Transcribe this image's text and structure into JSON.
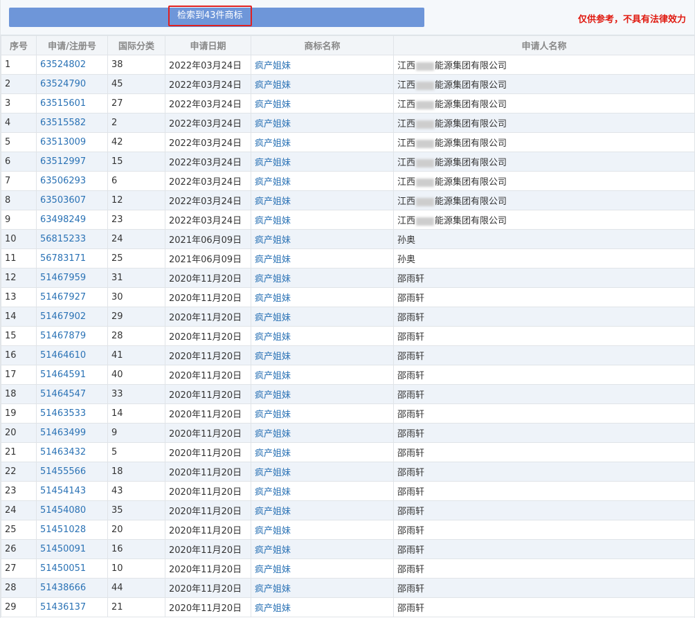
{
  "header": {
    "result_text": "检索到43件商标",
    "disclaimer": "仅供参考，不具有法律效力"
  },
  "table": {
    "columns": [
      "序号",
      "申请/注册号",
      "国际分类",
      "申请日期",
      "商标名称",
      "申请人名称"
    ],
    "rows": [
      {
        "seq": "1",
        "reg": "63524802",
        "cls": "38",
        "date": "2022年03月24日",
        "name": "疯产姐妹",
        "applicant_prefix": "江西",
        "applicant_suffix": "能源集团有限公司",
        "redacted": true
      },
      {
        "seq": "2",
        "reg": "63524790",
        "cls": "45",
        "date": "2022年03月24日",
        "name": "疯产姐妹",
        "applicant_prefix": "江西",
        "applicant_suffix": "能源集团有限公司",
        "redacted": true
      },
      {
        "seq": "3",
        "reg": "63515601",
        "cls": "27",
        "date": "2022年03月24日",
        "name": "疯产姐妹",
        "applicant_prefix": "江西",
        "applicant_suffix": "能源集团有限公司",
        "redacted": true
      },
      {
        "seq": "4",
        "reg": "63515582",
        "cls": "2",
        "date": "2022年03月24日",
        "name": "疯产姐妹",
        "applicant_prefix": "江西",
        "applicant_suffix": "能源集团有限公司",
        "redacted": true
      },
      {
        "seq": "5",
        "reg": "63513009",
        "cls": "42",
        "date": "2022年03月24日",
        "name": "疯产姐妹",
        "applicant_prefix": "江西",
        "applicant_suffix": "能源集团有限公司",
        "redacted": true
      },
      {
        "seq": "6",
        "reg": "63512997",
        "cls": "15",
        "date": "2022年03月24日",
        "name": "疯产姐妹",
        "applicant_prefix": "江西",
        "applicant_suffix": "能源集团有限公司",
        "redacted": true
      },
      {
        "seq": "7",
        "reg": "63506293",
        "cls": "6",
        "date": "2022年03月24日",
        "name": "疯产姐妹",
        "applicant_prefix": "江西",
        "applicant_suffix": "能源集团有限公司",
        "redacted": true
      },
      {
        "seq": "8",
        "reg": "63503607",
        "cls": "12",
        "date": "2022年03月24日",
        "name": "疯产姐妹",
        "applicant_prefix": "江西",
        "applicant_suffix": "能源集团有限公司",
        "redacted": true
      },
      {
        "seq": "9",
        "reg": "63498249",
        "cls": "23",
        "date": "2022年03月24日",
        "name": "疯产姐妹",
        "applicant_prefix": "江西",
        "applicant_suffix": "能源集团有限公司",
        "redacted": true
      },
      {
        "seq": "10",
        "reg": "56815233",
        "cls": "24",
        "date": "2021年06月09日",
        "name": "疯产姐妹",
        "applicant_prefix": "孙奥",
        "applicant_suffix": "",
        "redacted": false
      },
      {
        "seq": "11",
        "reg": "56783171",
        "cls": "25",
        "date": "2021年06月09日",
        "name": "疯产姐妹",
        "applicant_prefix": "孙奥",
        "applicant_suffix": "",
        "redacted": false
      },
      {
        "seq": "12",
        "reg": "51467959",
        "cls": "31",
        "date": "2020年11月20日",
        "name": "疯产姐妹",
        "applicant_prefix": "邵雨轩",
        "applicant_suffix": "",
        "redacted": false
      },
      {
        "seq": "13",
        "reg": "51467927",
        "cls": "30",
        "date": "2020年11月20日",
        "name": "疯产姐妹",
        "applicant_prefix": "邵雨轩",
        "applicant_suffix": "",
        "redacted": false
      },
      {
        "seq": "14",
        "reg": "51467902",
        "cls": "29",
        "date": "2020年11月20日",
        "name": "疯产姐妹",
        "applicant_prefix": "邵雨轩",
        "applicant_suffix": "",
        "redacted": false
      },
      {
        "seq": "15",
        "reg": "51467879",
        "cls": "28",
        "date": "2020年11月20日",
        "name": "疯产姐妹",
        "applicant_prefix": "邵雨轩",
        "applicant_suffix": "",
        "redacted": false
      },
      {
        "seq": "16",
        "reg": "51464610",
        "cls": "41",
        "date": "2020年11月20日",
        "name": "疯产姐妹",
        "applicant_prefix": "邵雨轩",
        "applicant_suffix": "",
        "redacted": false
      },
      {
        "seq": "17",
        "reg": "51464591",
        "cls": "40",
        "date": "2020年11月20日",
        "name": "疯产姐妹",
        "applicant_prefix": "邵雨轩",
        "applicant_suffix": "",
        "redacted": false
      },
      {
        "seq": "18",
        "reg": "51464547",
        "cls": "33",
        "date": "2020年11月20日",
        "name": "疯产姐妹",
        "applicant_prefix": "邵雨轩",
        "applicant_suffix": "",
        "redacted": false
      },
      {
        "seq": "19",
        "reg": "51463533",
        "cls": "14",
        "date": "2020年11月20日",
        "name": "疯产姐妹",
        "applicant_prefix": "邵雨轩",
        "applicant_suffix": "",
        "redacted": false
      },
      {
        "seq": "20",
        "reg": "51463499",
        "cls": "9",
        "date": "2020年11月20日",
        "name": "疯产姐妹",
        "applicant_prefix": "邵雨轩",
        "applicant_suffix": "",
        "redacted": false
      },
      {
        "seq": "21",
        "reg": "51463432",
        "cls": "5",
        "date": "2020年11月20日",
        "name": "疯产姐妹",
        "applicant_prefix": "邵雨轩",
        "applicant_suffix": "",
        "redacted": false
      },
      {
        "seq": "22",
        "reg": "51455566",
        "cls": "18",
        "date": "2020年11月20日",
        "name": "疯产姐妹",
        "applicant_prefix": "邵雨轩",
        "applicant_suffix": "",
        "redacted": false
      },
      {
        "seq": "23",
        "reg": "51454143",
        "cls": "43",
        "date": "2020年11月20日",
        "name": "疯产姐妹",
        "applicant_prefix": "邵雨轩",
        "applicant_suffix": "",
        "redacted": false
      },
      {
        "seq": "24",
        "reg": "51454080",
        "cls": "35",
        "date": "2020年11月20日",
        "name": "疯产姐妹",
        "applicant_prefix": "邵雨轩",
        "applicant_suffix": "",
        "redacted": false
      },
      {
        "seq": "25",
        "reg": "51451028",
        "cls": "20",
        "date": "2020年11月20日",
        "name": "疯产姐妹",
        "applicant_prefix": "邵雨轩",
        "applicant_suffix": "",
        "redacted": false
      },
      {
        "seq": "26",
        "reg": "51450091",
        "cls": "16",
        "date": "2020年11月20日",
        "name": "疯产姐妹",
        "applicant_prefix": "邵雨轩",
        "applicant_suffix": "",
        "redacted": false
      },
      {
        "seq": "27",
        "reg": "51450051",
        "cls": "10",
        "date": "2020年11月20日",
        "name": "疯产姐妹",
        "applicant_prefix": "邵雨轩",
        "applicant_suffix": "",
        "redacted": false
      },
      {
        "seq": "28",
        "reg": "51438666",
        "cls": "44",
        "date": "2020年11月20日",
        "name": "疯产姐妹",
        "applicant_prefix": "邵雨轩",
        "applicant_suffix": "",
        "redacted": false
      },
      {
        "seq": "29",
        "reg": "51436137",
        "cls": "21",
        "date": "2020年11月20日",
        "name": "疯产姐妹",
        "applicant_prefix": "邵雨轩",
        "applicant_suffix": "",
        "redacted": false
      }
    ]
  }
}
